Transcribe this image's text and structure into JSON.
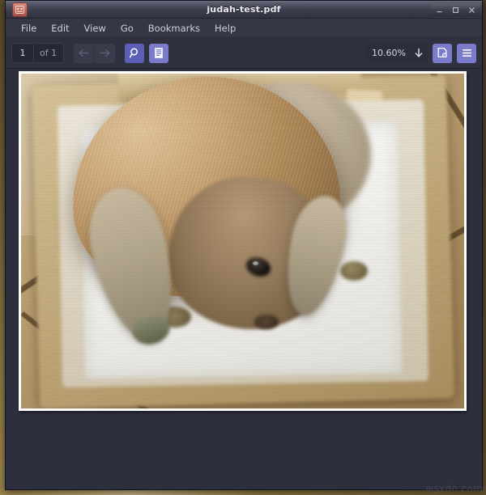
{
  "window": {
    "title": "judah-test.pdf",
    "app_icon": "pdf-document-icon",
    "controls": {
      "minimize": "minimize-icon",
      "maximize": "maximize-icon",
      "close": "close-icon"
    }
  },
  "menubar": {
    "items": [
      {
        "label": "File"
      },
      {
        "label": "Edit"
      },
      {
        "label": "View"
      },
      {
        "label": "Go"
      },
      {
        "label": "Bookmarks"
      },
      {
        "label": "Help"
      }
    ]
  },
  "toolbar": {
    "page_current": "1",
    "page_total_label": "of 1",
    "previous_page_icon": "arrow-left-icon",
    "next_page_icon": "arrow-right-icon",
    "find_icon": "search-icon",
    "sidebar_icon": "document-outline-icon",
    "zoom_level": "10.60%",
    "zoom_dropdown_icon": "arrow-down-icon",
    "view_options_icon": "page-settings-icon",
    "main_menu_icon": "hamburger-menu-icon"
  },
  "document": {
    "page_content_description": "photo-lop-eared-rabbit-in-box",
    "page_number": "1"
  },
  "watermark": {
    "text": "wsxdn.com"
  },
  "colors": {
    "accent": "#5d5fb6",
    "accent_light": "#7a7ccb",
    "titlebar": "#3b3d4d",
    "toolbar": "#30313f",
    "docview": "#2e2f3e",
    "page": "#fdfdfb"
  }
}
